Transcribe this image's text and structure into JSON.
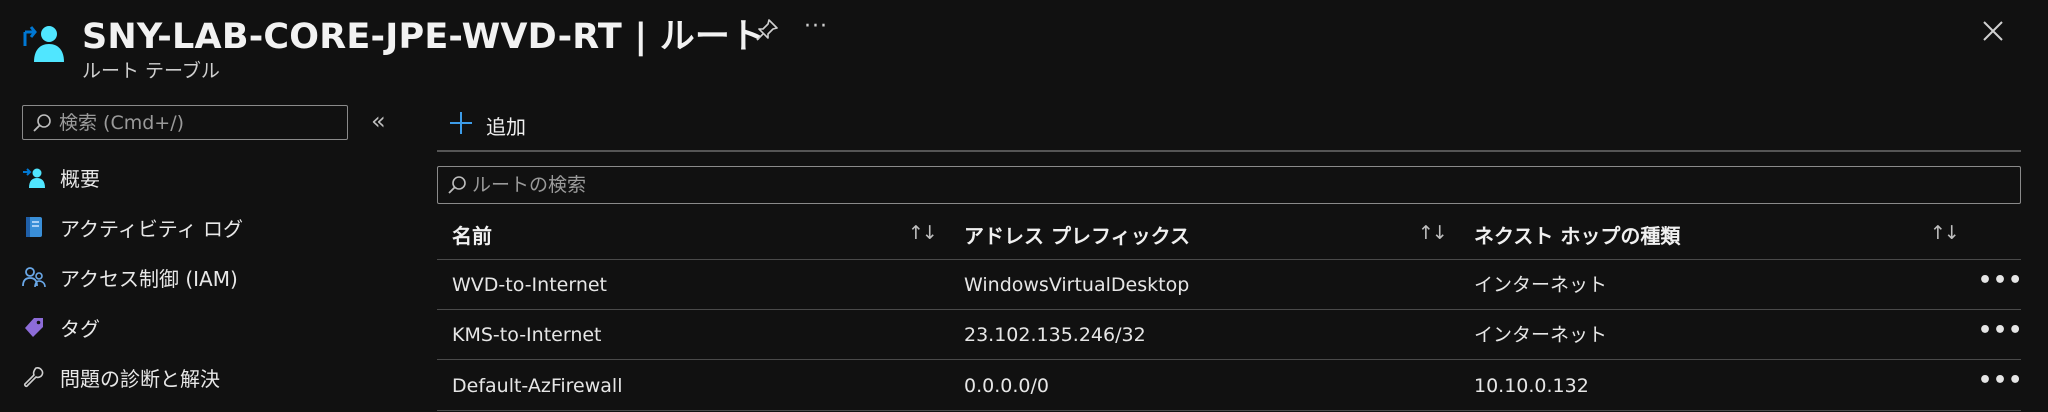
{
  "header": {
    "title": "SNY-LAB-CORE-JPE-WVD-RT | ルート",
    "subtitle": "ルート テーブル",
    "more": "···"
  },
  "sidebar": {
    "search_placeholder": "検索 (Cmd+/)",
    "collapse": "«",
    "items": [
      {
        "label": "概要",
        "icon": "overview-icon"
      },
      {
        "label": "アクティビティ ログ",
        "icon": "activity-log-icon"
      },
      {
        "label": "アクセス制御 (IAM)",
        "icon": "access-control-icon"
      },
      {
        "label": "タグ",
        "icon": "tag-icon"
      },
      {
        "label": "問題の診断と解決",
        "icon": "wrench-icon"
      }
    ]
  },
  "toolbar": {
    "add_label": "追加"
  },
  "routes_search": {
    "placeholder": "ルートの検索"
  },
  "table": {
    "columns": [
      "名前",
      "アドレス プレフィックス",
      "ネクスト ホップの種類"
    ],
    "sort_glyph": "↑↓",
    "row_more": "•••",
    "rows": [
      {
        "name": "WVD-to-Internet",
        "prefix": "WindowsVirtualDesktop",
        "next_hop": "インターネット"
      },
      {
        "name": "KMS-to-Internet",
        "prefix": "23.102.135.246/32",
        "next_hop": "インターネット"
      },
      {
        "name": "Default-AzFirewall",
        "prefix": "0.0.0.0/0",
        "next_hop": "10.10.0.132"
      }
    ]
  },
  "colors": {
    "background": "#111111",
    "accent_blue": "#0078d4",
    "icon_cyan": "#50e6ff"
  }
}
